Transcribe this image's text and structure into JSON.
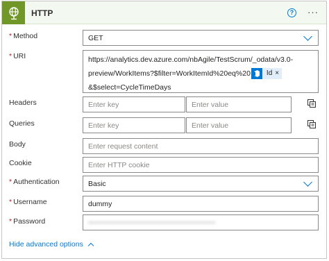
{
  "header": {
    "title": "HTTP",
    "help_glyph": "?",
    "more_glyph": "···",
    "accent": "#709727",
    "icon": "globe-icon"
  },
  "fields": {
    "method": {
      "label": "Method",
      "required": "*",
      "value": "GET"
    },
    "uri": {
      "label": "URI",
      "required": "*",
      "line1": "https://analytics.dev.azure.com/nbAgile/TestScrum/_odata/v3.0-",
      "line2": "preview/WorkItems?$filter=WorkItemId%20eq%20",
      "token_label": "Id",
      "token_close": "×",
      "line3": "&$select=CycleTimeDays"
    },
    "headers": {
      "label": "Headers",
      "key_placeholder": "Enter key",
      "value_placeholder": "Enter value"
    },
    "queries": {
      "label": "Queries",
      "key_placeholder": "Enter key",
      "value_placeholder": "Enter value"
    },
    "body": {
      "label": "Body",
      "placeholder": "Enter request content"
    },
    "cookie": {
      "label": "Cookie",
      "placeholder": "Enter HTTP cookie"
    },
    "authentication": {
      "label": "Authentication",
      "required": "*",
      "value": "Basic"
    },
    "username": {
      "label": "Username",
      "required": "*",
      "value": "dummy"
    },
    "password": {
      "label": "Password",
      "required": "*",
      "value": "••••••••••••••••••••••••••••••••••••••••••••"
    }
  },
  "footer": {
    "advanced_label": "Hide advanced options"
  },
  "colors": {
    "link": "#0078d4",
    "required": "#a4262c",
    "border": "#8a8886"
  }
}
